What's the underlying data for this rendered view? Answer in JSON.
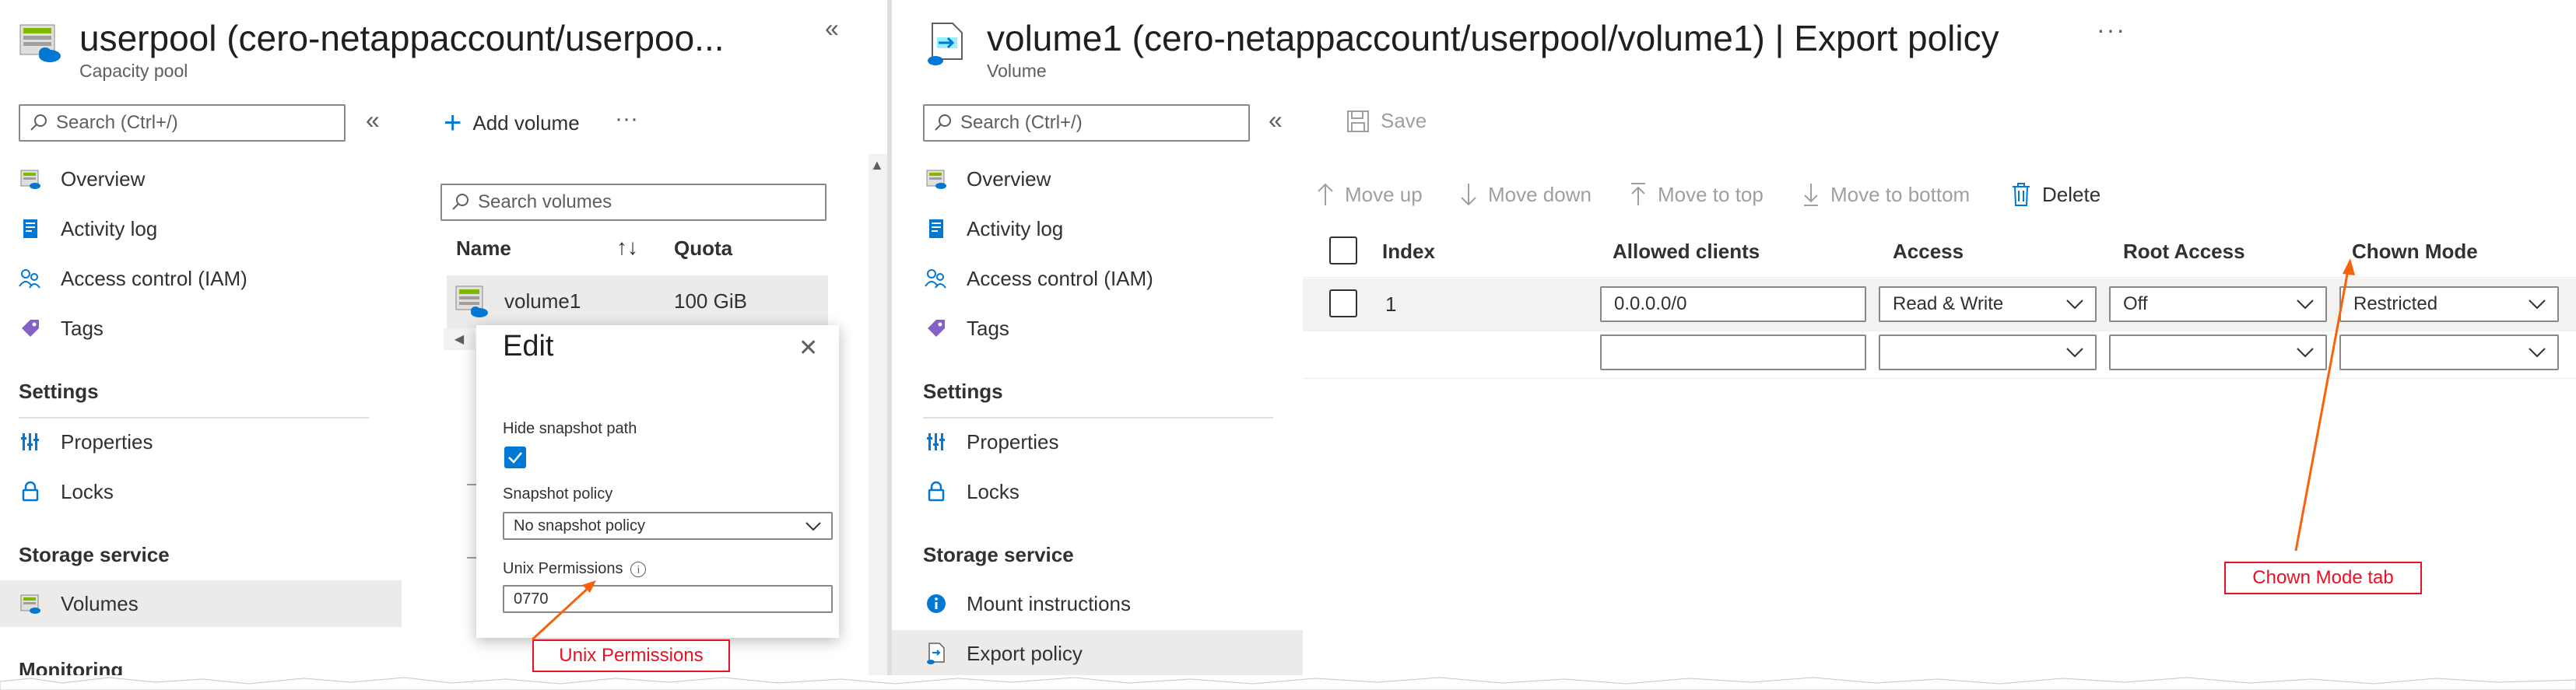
{
  "left": {
    "title": "userpool (cero-netappaccount/userpoo...",
    "subtitle": "Capacity pool",
    "collapse_glyph": "«",
    "search_placeholder": "Search (Ctrl+/)",
    "nav_collapse_glyph": "«",
    "nav": [
      {
        "label": "Overview",
        "icon": "overview-icon"
      },
      {
        "label": "Activity log",
        "icon": "activity-log-icon"
      },
      {
        "label": "Access control (IAM)",
        "icon": "iam-icon"
      },
      {
        "label": "Tags",
        "icon": "tag-icon"
      }
    ],
    "section_settings": "Settings",
    "settings_items": [
      {
        "label": "Properties",
        "icon": "properties-icon"
      },
      {
        "label": "Locks",
        "icon": "lock-icon"
      }
    ],
    "section_storage": "Storage service",
    "storage_items": [
      {
        "label": "Volumes",
        "icon": "volumes-icon",
        "active": true
      }
    ],
    "section_monitoring": "Monitoring",
    "add_volume": "Add volume",
    "more_glyph": "···",
    "search_volumes_placeholder": "Search volumes",
    "columns": {
      "name": "Name",
      "sort_glyph": "↑↓",
      "quota": "Quota"
    },
    "rows": [
      {
        "name": "volume1",
        "quota": "100 GiB"
      }
    ],
    "edit": {
      "title": "Edit",
      "close_glyph": "✕",
      "hide_snapshot_label": "Hide snapshot path",
      "hide_snapshot_checked": true,
      "snapshot_policy_label": "Snapshot policy",
      "snapshot_policy_value": "No snapshot policy",
      "unix_permissions_label": "Unix Permissions",
      "info_glyph": "i",
      "unix_permissions_value": "0770"
    },
    "callout": "Unix Permissions"
  },
  "right": {
    "title": "volume1 (cero-netappaccount/userpool/volume1) | Export policy",
    "subtitle": "Volume",
    "more_glyph": "···",
    "search_placeholder": "Search (Ctrl+/)",
    "nav_collapse_glyph": "«",
    "nav": [
      {
        "label": "Overview",
        "icon": "overview-icon"
      },
      {
        "label": "Activity log",
        "icon": "activity-log-icon"
      },
      {
        "label": "Access control (IAM)",
        "icon": "iam-icon"
      },
      {
        "label": "Tags",
        "icon": "tag-icon"
      }
    ],
    "section_settings": "Settings",
    "settings_items": [
      {
        "label": "Properties",
        "icon": "properties-icon"
      },
      {
        "label": "Locks",
        "icon": "lock-icon"
      }
    ],
    "section_storage": "Storage service",
    "storage_items": [
      {
        "label": "Mount instructions",
        "icon": "info-icon"
      },
      {
        "label": "Export policy",
        "icon": "export-policy-icon",
        "active": true
      }
    ],
    "save": "Save",
    "toolbar": {
      "move_up": "Move up",
      "move_down": "Move down",
      "move_to_top": "Move to top",
      "move_to_bottom": "Move to bottom",
      "delete": "Delete"
    },
    "columns": {
      "index": "Index",
      "allowed_clients": "Allowed clients",
      "access": "Access",
      "root_access": "Root Access",
      "chown_mode": "Chown Mode"
    },
    "rows": [
      {
        "index": "1",
        "allowed_clients": "0.0.0.0/0",
        "access": "Read & Write",
        "root_access": "Off",
        "chown_mode": "Restricted"
      },
      {
        "index": "",
        "allowed_clients": "",
        "access": "",
        "root_access": "",
        "chown_mode": ""
      }
    ],
    "callout": "Chown Mode tab"
  },
  "colors": {
    "accent": "#0078d4",
    "callout": "#e81123",
    "arrow": "#f7630c"
  }
}
